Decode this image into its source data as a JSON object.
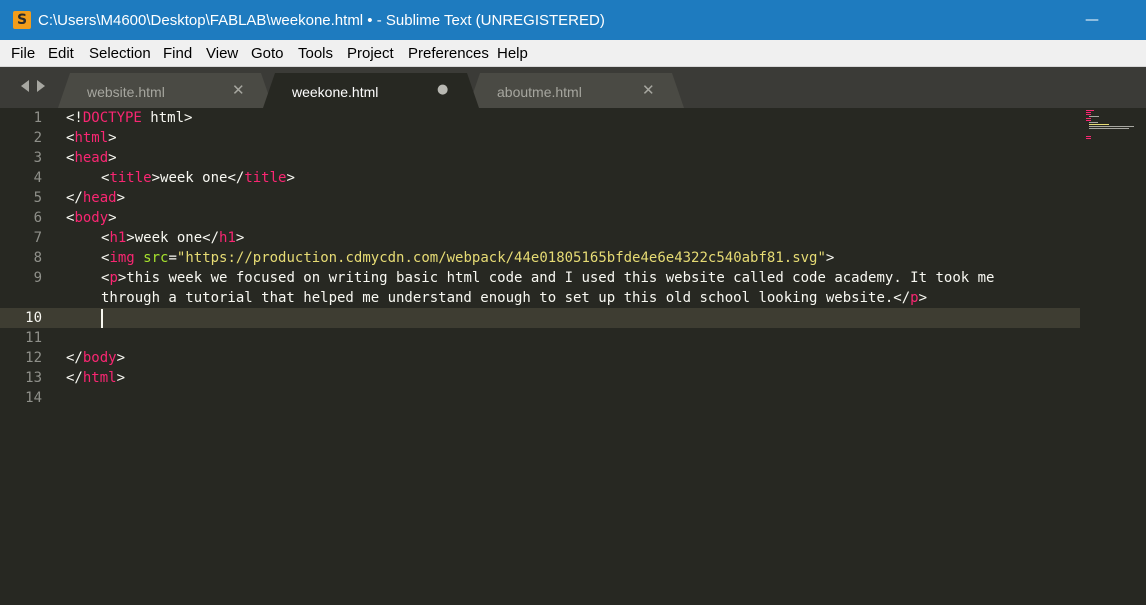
{
  "window": {
    "title": "C:\\Users\\M4600\\Desktop\\FABLAB\\weekone.html • - Sublime Text (UNREGISTERED)",
    "app_icon": "S",
    "minimize_glyph": "—",
    "colors": {
      "titlebar": "#1e7bbf",
      "menubar": "#f0f0f0",
      "tabbar": "#3b3b37",
      "editor_bg": "#272822",
      "tag": "#f92672",
      "attr": "#a6e22e",
      "string": "#e6db74",
      "text": "#f8f8f2",
      "gutter": "#8f908a"
    }
  },
  "menu": [
    {
      "label": "File"
    },
    {
      "label": "Edit"
    },
    {
      "label": "Selection"
    },
    {
      "label": "Find"
    },
    {
      "label": "View"
    },
    {
      "label": "Goto"
    },
    {
      "label": "Tools"
    },
    {
      "label": "Project"
    },
    {
      "label": "Preferences"
    },
    {
      "label": "Help"
    }
  ],
  "tabs": [
    {
      "label": "website.html",
      "close_glyph": "✕",
      "active": false,
      "modified": false
    },
    {
      "label": "weekone.html",
      "close_glyph": "●",
      "active": true,
      "modified": true
    },
    {
      "label": "aboutme.html",
      "close_glyph": "✕",
      "active": false,
      "modified": false
    }
  ],
  "editor": {
    "line_numbers": [
      "1",
      "2",
      "3",
      "4",
      "5",
      "6",
      "7",
      "8",
      "9",
      "",
      "10",
      "11",
      "12",
      "13",
      "14"
    ],
    "current_line": "10",
    "code": {
      "l1": {
        "a": "<!",
        "b": "DOCTYPE",
        "c": " html>"
      },
      "l2": {
        "a": "<",
        "b": "html",
        "c": ">"
      },
      "l3": {
        "a": "<",
        "b": "head",
        "c": ">"
      },
      "l4": {
        "a": "<",
        "b": "title",
        "c": ">week one</",
        "d": "title",
        "e": ">"
      },
      "l5": {
        "a": "</",
        "b": "head",
        "c": ">"
      },
      "l6": {
        "a": "<",
        "b": "body",
        "c": ">"
      },
      "l7": {
        "a": "<",
        "b": "h1",
        "c": ">week one</",
        "d": "h1",
        "e": ">"
      },
      "l8": {
        "a": "<",
        "b": "img",
        "c": " ",
        "d": "src",
        "e": "=",
        "f": "\"https://production.cdmycdn.com/webpack/44e01805165bfde4e6e4322c540abf81.svg\"",
        "g": ">"
      },
      "l9a": {
        "a": "<",
        "b": "p",
        "c": ">this week we focused on writing basic html code and I used this website called code academy. It took me"
      },
      "l9b": {
        "a": "through a tutorial that helped me understand enough to set up this old school looking website.</",
        "b": "p",
        "c": ">"
      },
      "l12": {
        "a": "</",
        "b": "body",
        "c": ">"
      },
      "l13": {
        "a": "</",
        "b": "html",
        "c": ">"
      }
    }
  }
}
